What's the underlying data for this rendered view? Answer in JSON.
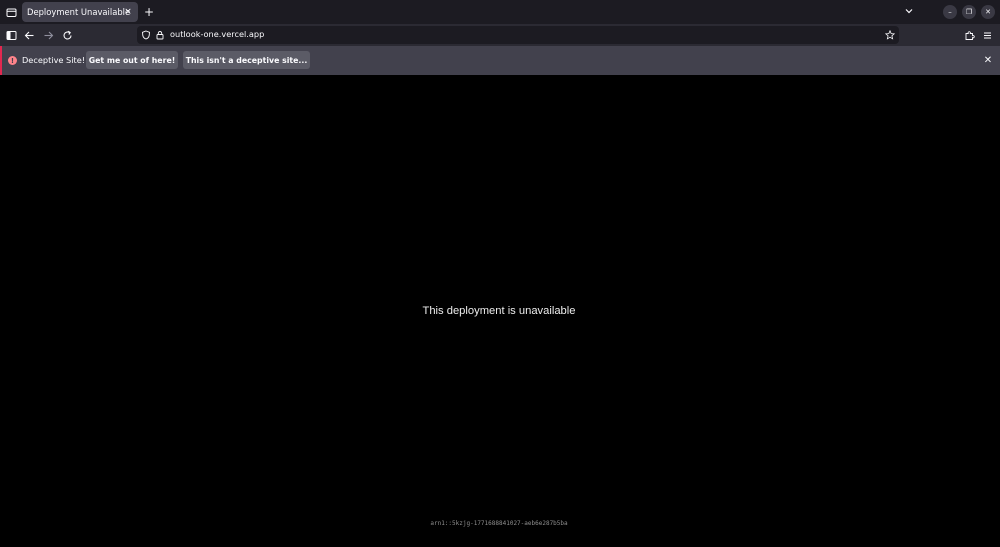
{
  "browser": {
    "active_tab_title": "Deployment Unavailable",
    "tab_close_glyph": "×",
    "new_tab_glyph": "+",
    "url": "outlook-one.vercel.app",
    "window_controls": {
      "minimize_glyph": "–",
      "restore_glyph": "❐",
      "close_glyph": "✕"
    }
  },
  "notification": {
    "message": "Deceptive Site!",
    "primary_button": "Get me out of here!",
    "secondary_button": "This isn't a deceptive site...",
    "close_glyph": "✕",
    "accent_color": "#e22850"
  },
  "page": {
    "message": "This deployment is unavailable",
    "trace_id": "arn1::5kzjg-1771688841027-aeb6e287b5ba"
  },
  "icons": {
    "tab_list": "tab-list-icon",
    "back": "back-arrow-icon",
    "forward": "forward-arrow-icon",
    "reload": "reload-icon",
    "tracking_protection": "shield-icon",
    "site_security": "lock-icon",
    "bookmark": "star-icon",
    "extensions": "puzzle-icon",
    "menu": "hamburger-menu-icon",
    "sidebar": "sidebar-icon",
    "warning": "warning-icon"
  }
}
